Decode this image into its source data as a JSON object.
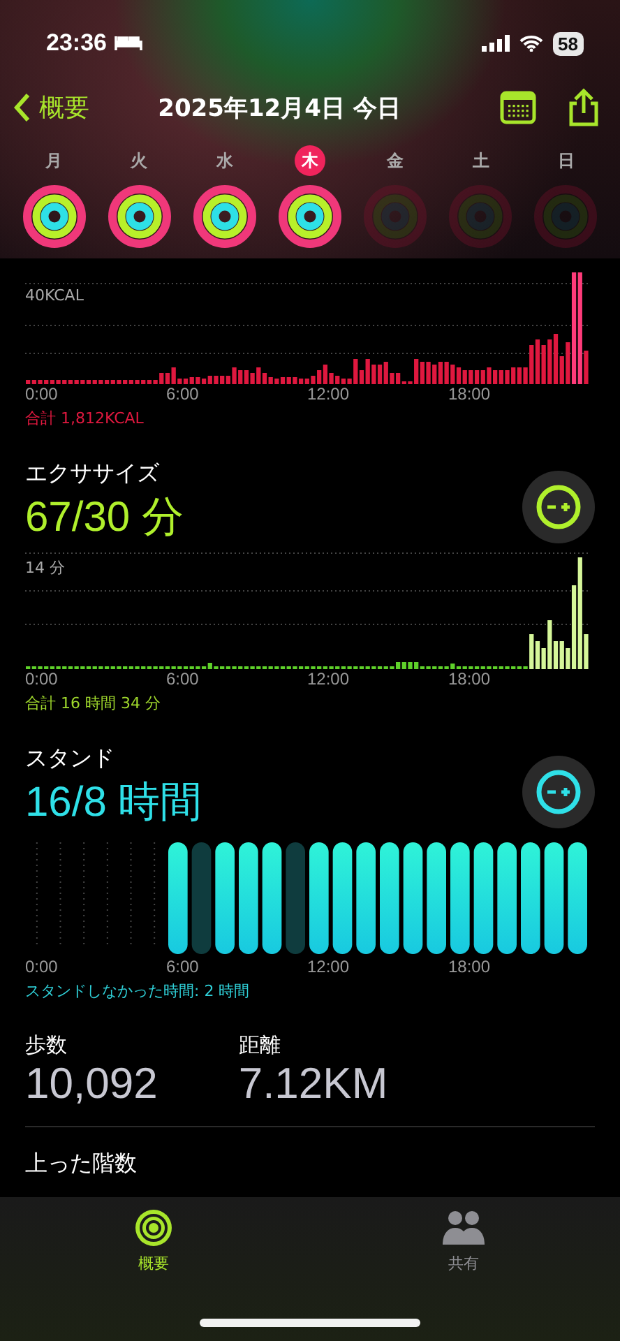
{
  "status_bar": {
    "time": "23:36",
    "battery": "58"
  },
  "nav": {
    "back": "概要",
    "title": "2025年12月4日 今日"
  },
  "week": [
    {
      "label": "月",
      "selected": false,
      "dimmed": false
    },
    {
      "label": "火",
      "selected": false,
      "dimmed": false
    },
    {
      "label": "水",
      "selected": false,
      "dimmed": false
    },
    {
      "label": "木",
      "selected": true,
      "dimmed": false
    },
    {
      "label": "金",
      "selected": false,
      "dimmed": true
    },
    {
      "label": "土",
      "selected": false,
      "dimmed": true
    },
    {
      "label": "日",
      "selected": false,
      "dimmed": true
    }
  ],
  "move": {
    "axis_max": "40KCAL",
    "x_labels": [
      "0:00",
      "6:00",
      "12:00",
      "18:00"
    ],
    "total": "合計 1,812KCAL"
  },
  "exercise": {
    "title": "エクササイズ",
    "value": "67/30 分",
    "axis_max": "14 分",
    "x_labels": [
      "0:00",
      "6:00",
      "12:00",
      "18:00"
    ],
    "total": "合計 16 時間 34 分"
  },
  "stand": {
    "title": "スタンド",
    "value": "16/8 時間",
    "x_labels": [
      "0:00",
      "6:00",
      "12:00",
      "18:00"
    ],
    "note": "スタンドしなかった時間: 2 時間"
  },
  "stats": [
    {
      "label": "歩数",
      "value": "10,092"
    },
    {
      "label": "距離",
      "value": "7.12KM"
    }
  ],
  "next_section": "上った階数",
  "tab_bar": [
    {
      "label": "概要",
      "selected": true
    },
    {
      "label": "共有",
      "selected": false
    }
  ]
}
